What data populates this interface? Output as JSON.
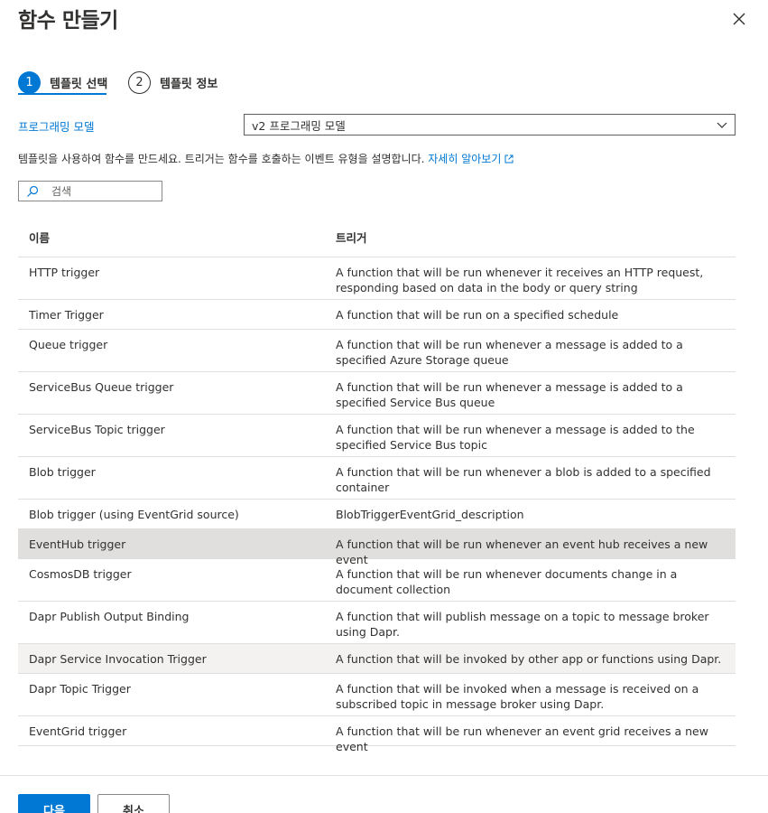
{
  "dialog": {
    "title": "함수 만들기"
  },
  "steps": [
    {
      "number": "1",
      "label": "템플릿 선택",
      "active": true
    },
    {
      "number": "2",
      "label": "템플릿 정보",
      "active": false
    }
  ],
  "programming_model": {
    "label": "프로그래밍 모델",
    "selected": "v2 프로그래밍 모델"
  },
  "description": {
    "text": "템플릿을 사용하여 함수를 만드세요. 트리거는 함수를 호출하는 이벤트 유형을 설명합니다. ",
    "learn_more": "자세히 알아보기"
  },
  "search": {
    "placeholder": "검색",
    "value": ""
  },
  "table": {
    "headers": {
      "name": "이름",
      "trigger": "트리거"
    },
    "rows": [
      {
        "name": "HTTP trigger",
        "description": "A function that will be run whenever it receives an HTTP request, responding based on data in the body or query string"
      },
      {
        "name": "Timer Trigger",
        "description": "A function that will be run on a specified schedule"
      },
      {
        "name": "Queue trigger",
        "description": "A function that will be run whenever a message is added to a specified Azure Storage queue"
      },
      {
        "name": "ServiceBus Queue trigger",
        "description": "A function that will be run whenever a message is added to a specified Service Bus queue"
      },
      {
        "name": "ServiceBus Topic trigger",
        "description": "A function that will be run whenever a message is added to the specified Service Bus topic"
      },
      {
        "name": "Blob trigger",
        "description": "A function that will be run whenever a blob is added to a specified container"
      },
      {
        "name": "Blob trigger (using EventGrid source)",
        "description": "BlobTriggerEventGrid_description"
      },
      {
        "name": "EventHub trigger",
        "description": "A function that will be run whenever an event hub receives a new event"
      },
      {
        "name": "CosmosDB trigger",
        "description": "A function that will be run whenever documents change in a document collection"
      },
      {
        "name": "Dapr Publish Output Binding",
        "description": "A function that will publish message on a topic to message broker using Dapr."
      },
      {
        "name": "Dapr Service Invocation Trigger",
        "description": "A function that will be invoked by other app or functions using Dapr."
      },
      {
        "name": "Dapr Topic Trigger",
        "description": "A function that will be invoked when a message is received on a subscribed topic in message broker using Dapr."
      },
      {
        "name": "EventGrid trigger",
        "description": "A function that will be run whenever an event grid receives a new event"
      }
    ]
  },
  "footer": {
    "next_label": "다음",
    "cancel_label": "취소"
  },
  "colors": {
    "accent": "#0078d4",
    "selected_row": "#e1dfdd",
    "hover_row": "#f3f2f1",
    "text": "#323130"
  }
}
